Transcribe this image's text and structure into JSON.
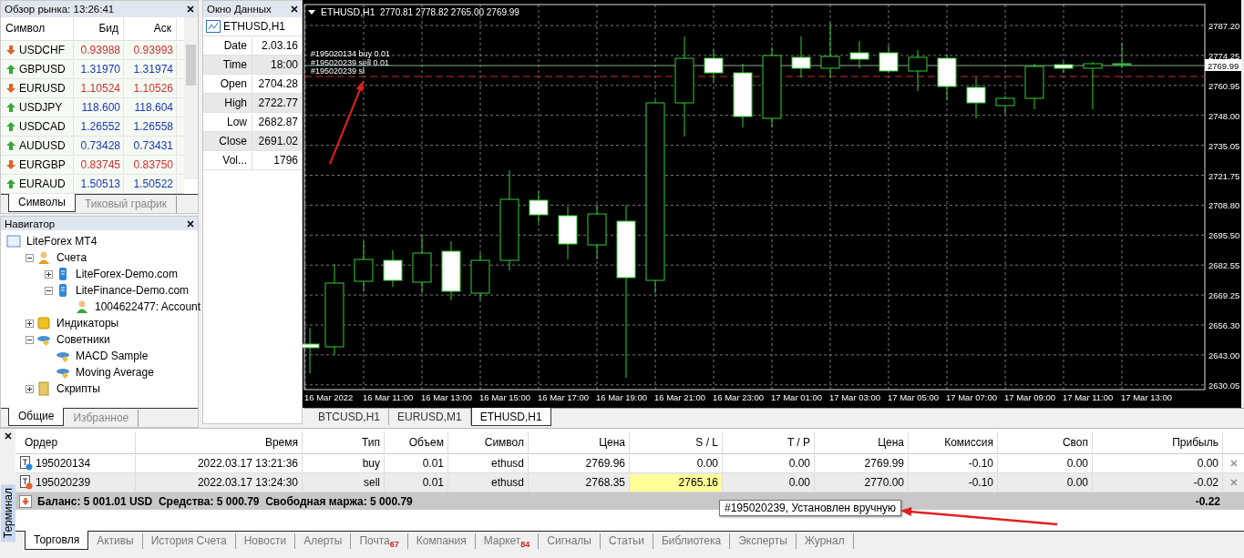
{
  "market_watch": {
    "title": "Обзор рынка: 13:26:41",
    "columns": [
      "Символ",
      "Бид",
      "Аск"
    ],
    "rows": [
      {
        "symbol": "USDCHF",
        "bid": "0.93988",
        "ask": "0.93993",
        "rising": false
      },
      {
        "symbol": "GBPUSD",
        "bid": "1.31970",
        "ask": "1.31974",
        "rising": true
      },
      {
        "symbol": "EURUSD",
        "bid": "1.10524",
        "ask": "1.10526",
        "rising": false
      },
      {
        "symbol": "USDJPY",
        "bid": "118.600",
        "ask": "118.604",
        "rising": true
      },
      {
        "symbol": "USDCAD",
        "bid": "1.26552",
        "ask": "1.26558",
        "rising": true
      },
      {
        "symbol": "AUDUSD",
        "bid": "0.73428",
        "ask": "0.73431",
        "rising": true
      },
      {
        "symbol": "EURGBP",
        "bid": "0.83745",
        "ask": "0.83750",
        "rising": false
      },
      {
        "symbol": "EURAUD",
        "bid": "1.50513",
        "ask": "1.50522",
        "rising": true
      }
    ],
    "tabs": [
      {
        "label": "Символы",
        "selected": true
      },
      {
        "label": "Тиковый график",
        "selected": false
      }
    ]
  },
  "navigator": {
    "title": "Навигатор",
    "tree": [
      {
        "label": "LiteForex MT4",
        "kind": "terminal",
        "children": [
          {
            "label": "Счета",
            "kind": "accounts",
            "expanded": true,
            "children": [
              {
                "label": "LiteForex-Demo.com",
                "kind": "server",
                "expanded": false
              },
              {
                "label": "LiteFinance-Demo.com",
                "kind": "server",
                "expanded": true,
                "children": [
                  {
                    "label": "1004622477: Account",
                    "kind": "account"
                  }
                ]
              }
            ]
          },
          {
            "label": "Индикаторы",
            "kind": "indicators",
            "expanded": false
          },
          {
            "label": "Советники",
            "kind": "experts",
            "expanded": true,
            "children": [
              {
                "label": "MACD Sample",
                "kind": "expert"
              },
              {
                "label": "Moving Average",
                "kind": "expert"
              }
            ]
          },
          {
            "label": "Скрипты",
            "kind": "scripts",
            "expanded": false
          }
        ]
      }
    ],
    "tabs": [
      {
        "label": "Общие",
        "selected": true
      },
      {
        "label": "Избранное",
        "selected": false
      }
    ]
  },
  "data_window": {
    "title": "Окно Данных",
    "symbol": "ETHUSD,H1",
    "rows": [
      {
        "label": "Date",
        "value": "2.03.16"
      },
      {
        "label": "Time",
        "value": "18:00"
      },
      {
        "label": "Open",
        "value": "2704.28"
      },
      {
        "label": "High",
        "value": "2722.77"
      },
      {
        "label": "Low",
        "value": "2682.87"
      },
      {
        "label": "Close",
        "value": "2691.02"
      },
      {
        "label": "Vol...",
        "value": "1796"
      }
    ]
  },
  "chart": {
    "symbol": "ETHUSD,H1",
    "ohlc": "2770.81 2778.82 2765.00 2769.99",
    "order_labels": [
      "#195020134 buy 0.01",
      "#195020239 sell 0.01",
      "#195020239 sl"
    ],
    "current_price": "2769.99",
    "price_axis": [
      "2787.20",
      "2774.25",
      "2760.95",
      "2748.00",
      "2735.05",
      "2721.75",
      "2708.80",
      "2695.50",
      "2682.55",
      "2669.25",
      "2656.30",
      "2643.00",
      "2630.05"
    ],
    "time_axis": [
      "16 Mar 2022",
      "16 Mar 11:00",
      "16 Mar 13:00",
      "16 Mar 15:00",
      "16 Mar 17:00",
      "16 Mar 19:00",
      "16 Mar 21:00",
      "16 Mar 23:00",
      "17 Mar 01:00",
      "17 Mar 03:00",
      "17 Mar 05:00",
      "17 Mar 07:00",
      "17 Mar 09:00",
      "17 Mar 11:00",
      "17 Mar 13:00"
    ],
    "tabs": [
      {
        "label": "BTCUSD,H1",
        "selected": false
      },
      {
        "label": "EURUSD,M1",
        "selected": false
      },
      {
        "label": "ETHUSD,H1",
        "selected": true
      }
    ]
  },
  "terminal": {
    "title": "Терминал",
    "columns": [
      "Ордер",
      "Время",
      "Тип",
      "Объем",
      "Символ",
      "Цена",
      "S / L",
      "T / P",
      "Цена",
      "Комиссия",
      "Своп",
      "Прибыль"
    ],
    "rows": [
      {
        "kind": "buy",
        "order": "195020134",
        "time": "2022.03.17 13:21:36",
        "type": "buy",
        "volume": "0.01",
        "symbol": "ethusd",
        "price": "2769.96",
        "sl": "0.00",
        "sl_highlighted": false,
        "tp": "0.00",
        "current": "2769.99",
        "commission": "-0.10",
        "swap": "0.00",
        "profit": "0.00"
      },
      {
        "kind": "sell",
        "order": "195020239",
        "time": "2022.03.17 13:24:30",
        "type": "sell",
        "volume": "0.01",
        "symbol": "ethusd",
        "price": "2768.35",
        "sl": "2765.16",
        "sl_highlighted": true,
        "tp": "0.00",
        "current": "2770.00",
        "commission": "-0.10",
        "swap": "0.00",
        "profit": "-0.02"
      }
    ],
    "summary": "Баланс: 5 001.01 USD  Средства: 5 000.79  Свободная маржа: 5 000.79",
    "total_profit": "-0.22",
    "tooltip": "#195020239, Установлен вручную",
    "tabs": [
      {
        "label": "Торговля",
        "selected": true
      },
      {
        "label": "Активы",
        "selected": false
      },
      {
        "label": "История Счета",
        "selected": false
      },
      {
        "label": "Новости",
        "selected": false
      },
      {
        "label": "Алерты",
        "selected": false
      },
      {
        "label": "Почта",
        "badge": "67",
        "selected": false
      },
      {
        "label": "Компания",
        "selected": false
      },
      {
        "label": "Маркет",
        "badge": "84",
        "selected": false
      },
      {
        "label": "Сигналы",
        "selected": false
      },
      {
        "label": "Статьи",
        "selected": false
      },
      {
        "label": "Библиотека",
        "selected": false
      },
      {
        "label": "Эксперты",
        "selected": false
      },
      {
        "label": "Журнал",
        "selected": false
      }
    ]
  }
}
